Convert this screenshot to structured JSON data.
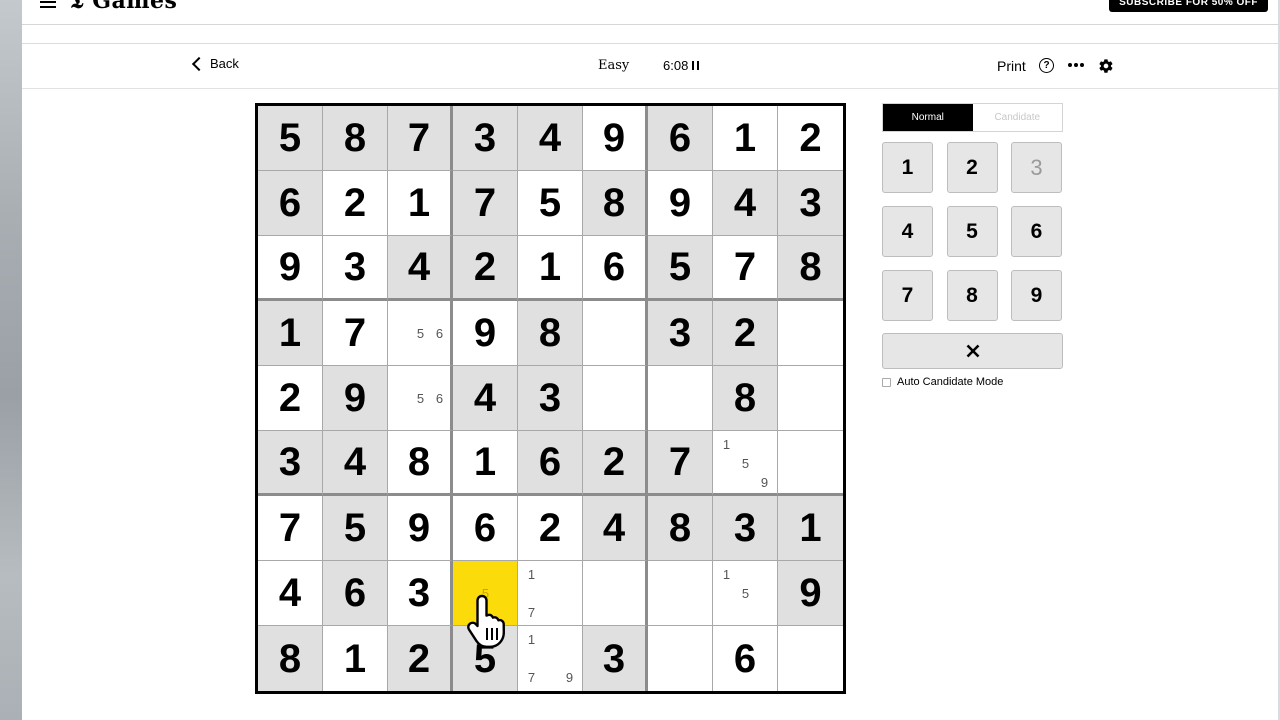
{
  "header": {
    "logo": "Games",
    "subscribe_label": "SUBSCRIBE FOR 50% OFF"
  },
  "toolbar": {
    "back_label": "Back",
    "difficulty": "Easy",
    "timer": "6:08",
    "print_label": "Print",
    "help_label": "?"
  },
  "icons": {
    "back": "chevron-left-icon",
    "pause": "pause-icon",
    "help": "question-circle-icon",
    "more": "ellipsis-icon",
    "settings": "gear-icon",
    "erase": "x-icon",
    "cursor": "hand-pointer-icon"
  },
  "colors": {
    "selected_cell": "#fcdb0a",
    "given_cell": "#e0e0e0",
    "empty_cell": "#ffffff"
  },
  "board": {
    "selected": [
      7,
      3
    ],
    "cells": [
      [
        {
          "v": "5",
          "s": 1
        },
        {
          "v": "8",
          "s": 1
        },
        {
          "v": "7",
          "s": 1
        },
        {
          "v": "3",
          "s": 1
        },
        {
          "v": "4",
          "s": 1
        },
        {
          "v": "9",
          "s": 0
        },
        {
          "v": "6",
          "s": 1
        },
        {
          "v": "1",
          "s": 0
        },
        {
          "v": "2",
          "s": 0
        }
      ],
      [
        {
          "v": "6",
          "s": 1
        },
        {
          "v": "2",
          "s": 0
        },
        {
          "v": "1",
          "s": 0
        },
        {
          "v": "7",
          "s": 1
        },
        {
          "v": "5",
          "s": 0
        },
        {
          "v": "8",
          "s": 1
        },
        {
          "v": "9",
          "s": 0
        },
        {
          "v": "4",
          "s": 1
        },
        {
          "v": "3",
          "s": 1
        }
      ],
      [
        {
          "v": "9",
          "s": 0
        },
        {
          "v": "3",
          "s": 0
        },
        {
          "v": "4",
          "s": 1
        },
        {
          "v": "2",
          "s": 1
        },
        {
          "v": "1",
          "s": 0
        },
        {
          "v": "6",
          "s": 0
        },
        {
          "v": "5",
          "s": 1
        },
        {
          "v": "7",
          "s": 0
        },
        {
          "v": "8",
          "s": 1
        }
      ],
      [
        {
          "v": "1",
          "s": 1
        },
        {
          "v": "7",
          "s": 0
        },
        {
          "v": "",
          "s": 0,
          "c": [
            "",
            "",
            "",
            "",
            "5",
            "6",
            "",
            "",
            ""
          ]
        },
        {
          "v": "9",
          "s": 0
        },
        {
          "v": "8",
          "s": 1
        },
        {
          "v": "",
          "s": 0
        },
        {
          "v": "3",
          "s": 1
        },
        {
          "v": "2",
          "s": 1
        },
        {
          "v": "",
          "s": 0
        }
      ],
      [
        {
          "v": "2",
          "s": 0
        },
        {
          "v": "9",
          "s": 1
        },
        {
          "v": "",
          "s": 0,
          "c": [
            "",
            "",
            "",
            "",
            "5",
            "6",
            "",
            "",
            ""
          ]
        },
        {
          "v": "4",
          "s": 1
        },
        {
          "v": "3",
          "s": 1
        },
        {
          "v": "",
          "s": 0
        },
        {
          "v": "",
          "s": 0
        },
        {
          "v": "8",
          "s": 1
        },
        {
          "v": "",
          "s": 0
        }
      ],
      [
        {
          "v": "3",
          "s": 1
        },
        {
          "v": "4",
          "s": 1
        },
        {
          "v": "8",
          "s": 0
        },
        {
          "v": "1",
          "s": 0
        },
        {
          "v": "6",
          "s": 1
        },
        {
          "v": "2",
          "s": 1
        },
        {
          "v": "7",
          "s": 1
        },
        {
          "v": "",
          "s": 0,
          "c": [
            "1",
            "",
            "",
            "",
            "5",
            "",
            "",
            "",
            "9"
          ]
        },
        {
          "v": "",
          "s": 0
        }
      ],
      [
        {
          "v": "7",
          "s": 0
        },
        {
          "v": "5",
          "s": 1
        },
        {
          "v": "9",
          "s": 0
        },
        {
          "v": "6",
          "s": 0
        },
        {
          "v": "2",
          "s": 0
        },
        {
          "v": "4",
          "s": 1
        },
        {
          "v": "8",
          "s": 1
        },
        {
          "v": "3",
          "s": 1
        },
        {
          "v": "1",
          "s": 1
        }
      ],
      [
        {
          "v": "4",
          "s": 0
        },
        {
          "v": "6",
          "s": 1
        },
        {
          "v": "3",
          "s": 0
        },
        {
          "v": "",
          "s": 0,
          "c": [
            "",
            "",
            "",
            "",
            "5",
            "",
            "",
            "",
            ""
          ]
        },
        {
          "v": "",
          "s": 0,
          "c": [
            "1",
            "",
            "",
            "",
            "",
            "",
            "7",
            "",
            ""
          ]
        },
        {
          "v": "",
          "s": 0
        },
        {
          "v": "",
          "s": 0
        },
        {
          "v": "",
          "s": 0,
          "c": [
            "1",
            "",
            "",
            "",
            "5",
            "",
            "",
            "",
            ""
          ]
        },
        {
          "v": "9",
          "s": 1
        }
      ],
      [
        {
          "v": "8",
          "s": 1
        },
        {
          "v": "1",
          "s": 0
        },
        {
          "v": "2",
          "s": 1
        },
        {
          "v": "5",
          "s": 1
        },
        {
          "v": "",
          "s": 0,
          "c": [
            "1",
            "",
            "",
            "",
            "",
            "",
            "7",
            "",
            "9"
          ]
        },
        {
          "v": "3",
          "s": 1
        },
        {
          "v": "",
          "s": 0
        },
        {
          "v": "6",
          "s": 0
        },
        {
          "v": "",
          "s": 0
        }
      ]
    ]
  },
  "panel": {
    "mode_normal": "Normal",
    "mode_candidate": "Candidate",
    "numbers": [
      {
        "label": "1",
        "done": false
      },
      {
        "label": "2",
        "done": false
      },
      {
        "label": "3",
        "done": true
      },
      {
        "label": "4",
        "done": false
      },
      {
        "label": "5",
        "done": false
      },
      {
        "label": "6",
        "done": false
      },
      {
        "label": "7",
        "done": false
      },
      {
        "label": "8",
        "done": false
      },
      {
        "label": "9",
        "done": false
      }
    ],
    "auto_candidate_label": "Auto Candidate Mode"
  }
}
